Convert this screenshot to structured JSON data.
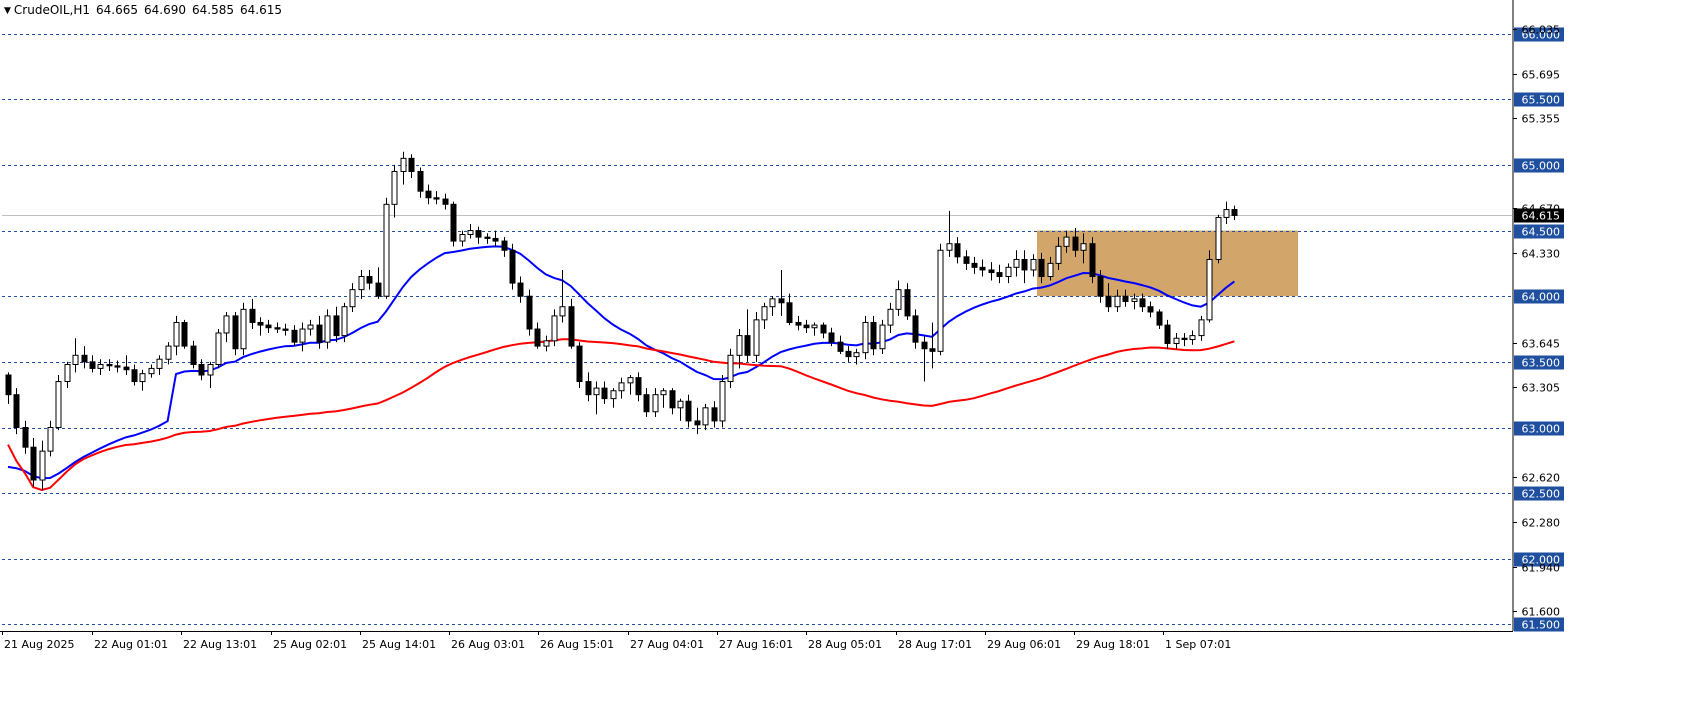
{
  "header": {
    "symbol": "CrudeOIL,H1",
    "open": "64.665",
    "high": "64.690",
    "low": "64.585",
    "close": "64.615"
  },
  "colors": {
    "bull": "#ffffff",
    "bear": "#000000",
    "ma_fast": "#0000ff",
    "ma_slow": "#ff0000",
    "zone": "#d2a56b",
    "level_line": "#1f4f9f",
    "current_price_bg": "#000000"
  },
  "chart_data": {
    "type": "candlestick",
    "title": "CrudeOIL,H1",
    "price_range": [
      61.45,
      66.18
    ],
    "y_ticks": [
      "66.035",
      "65.695",
      "65.355",
      "64.670",
      "64.330",
      "63.645",
      "63.305",
      "62.620",
      "62.280",
      "61.940",
      "61.600"
    ],
    "levels": [
      "66.000",
      "65.500",
      "65.000",
      "64.500",
      "64.000",
      "63.500",
      "63.000",
      "62.500",
      "62.000",
      "61.500"
    ],
    "current_price": "64.615",
    "x_labels": [
      "21 Aug 2025",
      "22 Aug 01:01",
      "22 Aug 13:01",
      "25 Aug 02:01",
      "25 Aug 14:01",
      "26 Aug 03:01",
      "26 Aug 15:01",
      "27 Aug 04:01",
      "27 Aug 16:01",
      "28 Aug 05:01",
      "28 Aug 17:01",
      "29 Aug 06:01",
      "29 Aug 18:01",
      "1 Sep 07:01"
    ],
    "zone": {
      "price_low": 64.0,
      "price_high": 64.5,
      "start_label": "29 Aug 06:01"
    },
    "ohlc": [
      [
        63.4,
        63.42,
        63.18,
        63.25
      ],
      [
        63.25,
        63.3,
        62.95,
        63.0
      ],
      [
        63.0,
        63.05,
        62.8,
        62.85
      ],
      [
        62.85,
        62.92,
        62.55,
        62.6
      ],
      [
        62.6,
        62.9,
        62.52,
        62.82
      ],
      [
        62.82,
        63.05,
        62.78,
        63.0
      ],
      [
        63.0,
        63.4,
        62.98,
        63.35
      ],
      [
        63.35,
        63.5,
        63.3,
        63.48
      ],
      [
        63.48,
        63.68,
        63.42,
        63.55
      ],
      [
        63.55,
        63.62,
        63.45,
        63.5
      ],
      [
        63.5,
        63.55,
        63.42,
        63.45
      ],
      [
        63.45,
        63.52,
        63.4,
        63.48
      ],
      [
        63.48,
        63.52,
        63.43,
        63.47
      ],
      [
        63.47,
        63.51,
        63.42,
        63.46
      ],
      [
        63.46,
        63.55,
        63.4,
        63.44
      ],
      [
        63.44,
        63.48,
        63.32,
        63.35
      ],
      [
        63.35,
        63.44,
        63.28,
        63.41
      ],
      [
        63.41,
        63.48,
        63.38,
        63.45
      ],
      [
        63.45,
        63.55,
        63.4,
        63.52
      ],
      [
        63.52,
        63.65,
        63.48,
        63.62
      ],
      [
        63.62,
        63.85,
        63.55,
        63.8
      ],
      [
        63.8,
        63.82,
        63.6,
        63.62
      ],
      [
        63.62,
        63.66,
        63.45,
        63.48
      ],
      [
        63.48,
        63.52,
        63.36,
        63.4
      ],
      [
        63.4,
        63.5,
        63.3,
        63.48
      ],
      [
        63.48,
        63.75,
        63.45,
        63.72
      ],
      [
        63.72,
        63.88,
        63.65,
        63.85
      ],
      [
        63.85,
        63.88,
        63.55,
        63.6
      ],
      [
        63.6,
        63.95,
        63.55,
        63.9
      ],
      [
        63.9,
        63.98,
        63.75,
        63.8
      ],
      [
        63.8,
        63.84,
        63.7,
        63.78
      ],
      [
        63.78,
        63.82,
        63.72,
        63.76
      ],
      [
        63.76,
        63.8,
        63.72,
        63.75
      ],
      [
        63.75,
        63.79,
        63.7,
        63.74
      ],
      [
        63.74,
        63.78,
        63.62,
        63.65
      ],
      [
        63.65,
        63.8,
        63.58,
        63.75
      ],
      [
        63.75,
        63.82,
        63.7,
        63.78
      ],
      [
        63.78,
        63.85,
        63.6,
        63.65
      ],
      [
        63.65,
        63.9,
        63.6,
        63.85
      ],
      [
        63.85,
        63.92,
        63.65,
        63.7
      ],
      [
        63.7,
        63.95,
        63.65,
        63.92
      ],
      [
        63.92,
        64.1,
        63.88,
        64.05
      ],
      [
        64.05,
        64.2,
        63.98,
        64.15
      ],
      [
        64.15,
        64.2,
        64.05,
        64.1
      ],
      [
        64.1,
        64.22,
        63.98,
        64.0
      ],
      [
        64.0,
        64.75,
        63.98,
        64.7
      ],
      [
        64.7,
        65.0,
        64.6,
        64.95
      ],
      [
        64.95,
        65.1,
        64.85,
        65.05
      ],
      [
        65.05,
        65.08,
        64.9,
        64.95
      ],
      [
        64.95,
        64.98,
        64.75,
        64.8
      ],
      [
        64.8,
        64.85,
        64.7,
        64.75
      ],
      [
        64.75,
        64.8,
        64.7,
        64.74
      ],
      [
        64.74,
        64.78,
        64.66,
        64.7
      ],
      [
        64.7,
        64.72,
        64.38,
        64.42
      ],
      [
        64.42,
        64.5,
        64.38,
        64.47
      ],
      [
        64.47,
        64.55,
        64.44,
        64.5
      ],
      [
        64.5,
        64.53,
        64.4,
        64.45
      ],
      [
        64.45,
        64.48,
        64.4,
        64.44
      ],
      [
        64.44,
        64.5,
        64.38,
        64.42
      ],
      [
        64.42,
        64.45,
        64.3,
        64.35
      ],
      [
        64.35,
        64.4,
        64.05,
        64.1
      ],
      [
        64.1,
        64.15,
        63.95,
        64.0
      ],
      [
        64.0,
        64.05,
        63.7,
        63.75
      ],
      [
        63.75,
        63.8,
        63.6,
        63.62
      ],
      [
        63.62,
        63.7,
        63.58,
        63.66
      ],
      [
        63.66,
        63.9,
        63.62,
        63.85
      ],
      [
        63.85,
        64.2,
        63.8,
        63.92
      ],
      [
        63.92,
        63.98,
        63.6,
        63.62
      ],
      [
        63.62,
        63.65,
        63.3,
        63.35
      ],
      [
        63.35,
        63.42,
        63.2,
        63.25
      ],
      [
        63.25,
        63.35,
        63.1,
        63.3
      ],
      [
        63.3,
        63.35,
        63.18,
        63.22
      ],
      [
        63.22,
        63.3,
        63.15,
        63.28
      ],
      [
        63.28,
        63.38,
        63.22,
        63.34
      ],
      [
        63.34,
        63.4,
        63.25,
        63.38
      ],
      [
        63.38,
        63.42,
        63.2,
        63.25
      ],
      [
        63.25,
        63.3,
        63.08,
        63.12
      ],
      [
        63.12,
        63.3,
        63.08,
        63.25
      ],
      [
        63.25,
        63.3,
        63.15,
        63.28
      ],
      [
        63.28,
        63.3,
        63.1,
        63.15
      ],
      [
        63.15,
        63.22,
        63.05,
        63.2
      ],
      [
        63.2,
        63.25,
        63.0,
        63.05
      ],
      [
        63.05,
        63.15,
        62.95,
        63.02
      ],
      [
        63.02,
        63.18,
        62.98,
        63.15
      ],
      [
        63.15,
        63.2,
        63.0,
        63.05
      ],
      [
        63.05,
        63.4,
        63.0,
        63.35
      ],
      [
        63.35,
        63.6,
        63.3,
        63.55
      ],
      [
        63.55,
        63.75,
        63.45,
        63.7
      ],
      [
        63.7,
        63.9,
        63.5,
        63.55
      ],
      [
        63.55,
        63.88,
        63.5,
        63.82
      ],
      [
        63.82,
        63.95,
        63.75,
        63.92
      ],
      [
        63.92,
        64.0,
        63.85,
        63.98
      ],
      [
        63.98,
        64.2,
        63.85,
        63.95
      ],
      [
        63.95,
        64.02,
        63.78,
        63.8
      ],
      [
        63.8,
        63.85,
        63.74,
        63.78
      ],
      [
        63.78,
        63.82,
        63.72,
        63.76
      ],
      [
        63.76,
        63.8,
        63.7,
        63.78
      ],
      [
        63.78,
        63.8,
        63.68,
        63.72
      ],
      [
        63.72,
        63.76,
        63.62,
        63.65
      ],
      [
        63.65,
        63.7,
        63.56,
        63.58
      ],
      [
        63.58,
        63.62,
        63.5,
        63.54
      ],
      [
        63.54,
        63.6,
        63.48,
        63.57
      ],
      [
        63.57,
        63.85,
        63.52,
        63.8
      ],
      [
        63.8,
        63.85,
        63.55,
        63.6
      ],
      [
        63.6,
        63.82,
        63.56,
        63.78
      ],
      [
        63.78,
        63.95,
        63.72,
        63.9
      ],
      [
        63.9,
        64.12,
        63.85,
        64.05
      ],
      [
        64.05,
        64.1,
        63.82,
        63.85
      ],
      [
        63.85,
        63.9,
        63.6,
        63.65
      ],
      [
        63.65,
        63.7,
        63.35,
        63.6
      ],
      [
        63.6,
        63.8,
        63.45,
        63.58
      ],
      [
        63.58,
        64.4,
        63.55,
        64.35
      ],
      [
        64.35,
        64.65,
        64.3,
        64.4
      ],
      [
        64.4,
        64.45,
        64.25,
        64.3
      ],
      [
        64.3,
        64.35,
        64.2,
        64.25
      ],
      [
        64.25,
        64.3,
        64.17,
        64.22
      ],
      [
        64.22,
        64.28,
        64.15,
        64.2
      ],
      [
        64.2,
        64.26,
        64.12,
        64.18
      ],
      [
        64.18,
        64.24,
        64.1,
        64.15
      ],
      [
        64.15,
        64.25,
        64.1,
        64.22
      ],
      [
        64.22,
        64.35,
        64.15,
        64.28
      ],
      [
        64.28,
        64.35,
        64.1,
        64.2
      ],
      [
        64.2,
        64.32,
        64.15,
        64.28
      ],
      [
        64.28,
        64.33,
        64.1,
        64.15
      ],
      [
        64.15,
        64.3,
        64.12,
        64.25
      ],
      [
        64.25,
        64.45,
        64.2,
        64.38
      ],
      [
        64.38,
        64.5,
        64.33,
        64.45
      ],
      [
        64.45,
        64.52,
        64.3,
        64.35
      ],
      [
        64.35,
        64.48,
        64.25,
        64.4
      ],
      [
        64.4,
        64.45,
        64.1,
        64.15
      ],
      [
        64.15,
        64.2,
        63.95,
        64.0
      ],
      [
        64.0,
        64.1,
        63.88,
        63.92
      ],
      [
        63.92,
        64.05,
        63.88,
        64.0
      ],
      [
        64.0,
        64.05,
        63.92,
        63.96
      ],
      [
        63.96,
        64.02,
        63.9,
        63.98
      ],
      [
        63.98,
        64.02,
        63.88,
        63.92
      ],
      [
        63.92,
        63.96,
        63.84,
        63.88
      ],
      [
        63.88,
        63.9,
        63.75,
        63.78
      ],
      [
        63.78,
        63.82,
        63.6,
        63.64
      ],
      [
        63.64,
        63.72,
        63.6,
        63.68
      ],
      [
        63.68,
        63.72,
        63.62,
        63.67
      ],
      [
        63.67,
        63.74,
        63.63,
        63.7
      ],
      [
        63.7,
        63.85,
        63.66,
        63.82
      ],
      [
        63.82,
        64.35,
        63.8,
        64.28
      ],
      [
        64.28,
        64.62,
        64.25,
        64.6
      ],
      [
        64.6,
        64.72,
        64.55,
        64.66
      ],
      [
        64.66,
        64.69,
        64.58,
        64.615
      ]
    ]
  }
}
